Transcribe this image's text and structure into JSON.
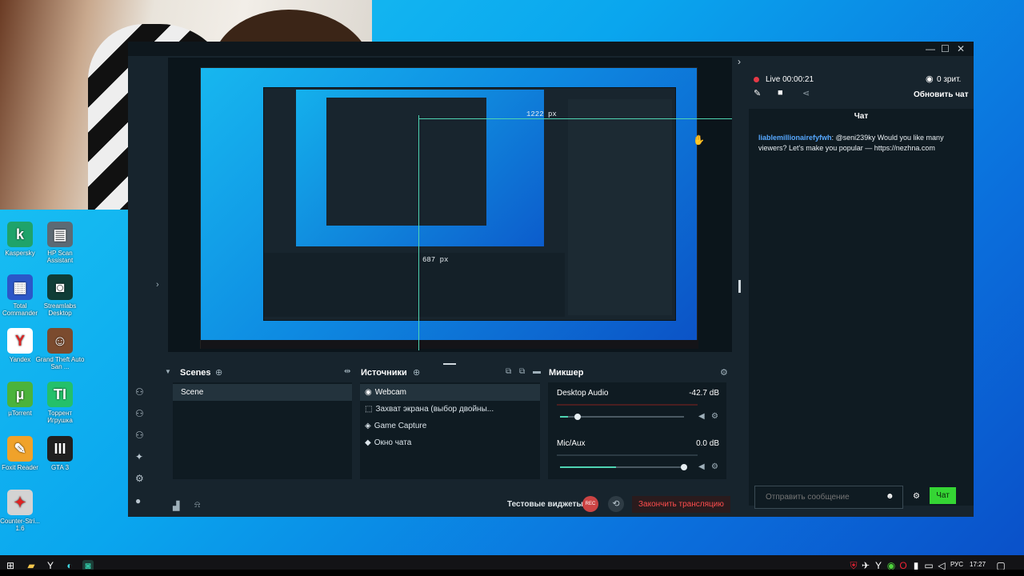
{
  "desktop": {
    "icons": [
      {
        "label": "Kaspersky",
        "glyph": "k",
        "color": "#1fa36a"
      },
      {
        "label": "HP Scan Assistant",
        "glyph": "▤",
        "color": "#5c6a74"
      },
      {
        "label": "Total Commander",
        "glyph": "▦",
        "color": "#2b57c8"
      },
      {
        "label": "Streamlabs Desktop",
        "glyph": "◙",
        "color": "#0f3d37"
      },
      {
        "label": "Yandex",
        "glyph": "Y",
        "color": "#ffffff"
      },
      {
        "label": "Grand Theft Auto San ...",
        "glyph": "☺",
        "color": "#7b4b2e"
      },
      {
        "label": "µTorrent",
        "glyph": "µ",
        "color": "#4bb33b"
      },
      {
        "label": "Торрент Игрушка",
        "glyph": "TI",
        "color": "#24c06a"
      },
      {
        "label": "Foxit Reader",
        "glyph": "✎",
        "color": "#f0a22a"
      },
      {
        "label": "GTA 3",
        "glyph": "III",
        "color": "#202020"
      },
      {
        "label": "Counter-Stri... 1.6",
        "glyph": "✦",
        "color": "#d3d3d3"
      }
    ]
  },
  "preview": {
    "ruler_h": "1222 px",
    "ruler_v": "687 px"
  },
  "panels": {
    "scenes": {
      "title": "Scenes",
      "items": [
        "Scene"
      ]
    },
    "sources": {
      "title": "Источники",
      "items": [
        "Webcam",
        "Захват экрана (выбор двойны...",
        "Game Capture",
        "Окно чата"
      ]
    },
    "mixer": {
      "title": "Микшер",
      "channels": [
        {
          "name": "Desktop Audio",
          "level": "-42.7 dB",
          "volume": 0.14
        },
        {
          "name": "Mic/Aux",
          "level": "0.0 dB",
          "volume": 1.0
        }
      ]
    }
  },
  "footer": {
    "test_widgets": "Тестовые виджеты",
    "rec_label": "REC",
    "end_stream": "Закончить трансляцию"
  },
  "chat": {
    "live_label": "Live 00:00:21",
    "viewers": "0 зрит.",
    "refresh_chat": "Обновить чат",
    "title": "Чат",
    "messages": [
      {
        "user": "liablemillionairefyfwh",
        "text": ": @seni239ky Would you like many viewers? Let's make you popular — https://nezhna.com"
      }
    ],
    "input_placeholder": "Отправить сообщение",
    "send_label": "Чат"
  },
  "taskbar": {
    "lang": "РУС",
    "time": "17:27"
  },
  "colors": {
    "accent": "#4fd4b2",
    "live_dot": "#e63946",
    "send": "#35d534",
    "end_stream": "#ff4d4d"
  }
}
